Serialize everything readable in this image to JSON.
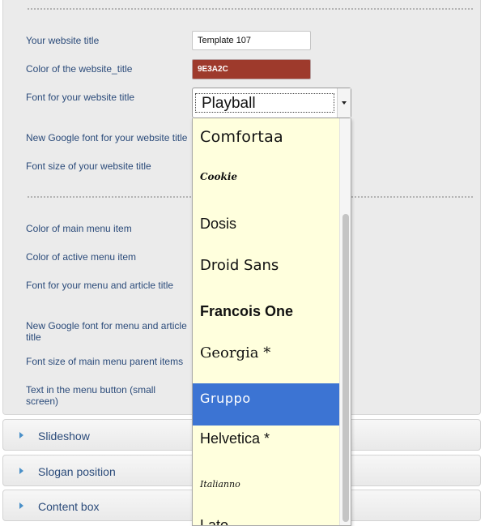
{
  "form": {
    "website_title_label": "Your website title",
    "website_title_value": "Template 107",
    "title_color_label": "Color of the website_title",
    "title_color_value": "9E3A2C",
    "title_color_hex": "#9E3A2C",
    "title_font_label": "Font for your website title",
    "title_font_selected": "Playball",
    "new_google_font_title_label": "New Google font for your website title",
    "title_font_size_label": "Font size of your website title",
    "main_menu_color_label": "Color of main menu item",
    "active_menu_color_label": "Color of active menu item",
    "menu_article_font_label": "Font for your menu and article title",
    "new_google_font_menu_label": "New Google font for menu and article title",
    "menu_parent_font_size_label": "Font size of main menu parent items",
    "menu_button_text_label": "Text in the menu button (small screen)"
  },
  "dropdown": {
    "options": [
      "Comfortaa",
      "Cookie",
      "Dosis",
      "Droid Sans",
      "Francois One",
      "Georgia *",
      "Gruppo",
      "Helvetica *",
      "Italianno",
      "Lato"
    ],
    "selected": "Gruppo",
    "selected_color": "#3C74D3"
  },
  "accordion": [
    "Slideshow",
    "Slogan position",
    "Content box"
  ],
  "icons": {
    "select_arrow": "chevron-down-icon",
    "accordion_toggle": "triangle-right-icon"
  }
}
